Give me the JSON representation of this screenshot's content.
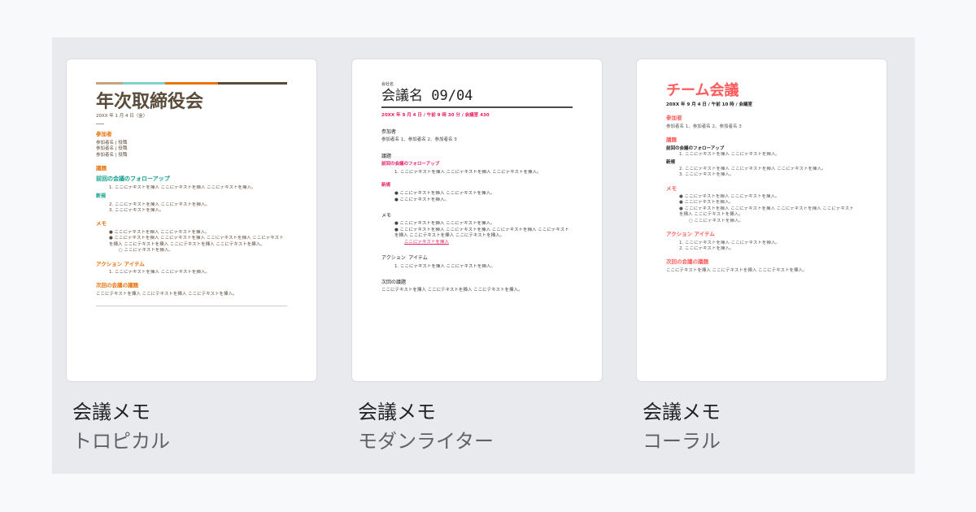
{
  "templates": [
    {
      "name": "会議メモ",
      "style": "トロピカル",
      "preview": {
        "title": "年次取締役会",
        "date": "20XX 年 1 月 4 日（金）",
        "attendees_heading": "参加者",
        "attendees": [
          "参加者名 | 役職",
          "参加者名 | 役職",
          "参加者名 | 役職"
        ],
        "agenda_heading": "議題",
        "followup_heading": "前回の会議のフォローアップ",
        "followup_items": [
          "1. ここにテキストを挿入 ここにテキストを挿入 ここにテキストを挿入。"
        ],
        "new_heading": "新規",
        "new_items": [
          "2. ここにテキストを挿入 ここにテキストを挿入。",
          "3. ここにテキストを挿入。"
        ],
        "notes_heading": "メモ",
        "notes_items": [
          "● ここにテキストを挿入 ここにテキストを挿入。",
          "● ここにテキストを挿入 ここにテキストを挿入 ここにテキストを挿入 ここにテキストを挿入 ここにテキストを挿入 ここにテキストを挿入 ここにテキストを挿入。",
          "○ ここにテキストを挿入。"
        ],
        "action_heading": "アクション アイテム",
        "action_items": [
          "1. ここにテキストを挿入 ここにテキストを挿入。"
        ],
        "next_heading": "次回の会議の議題",
        "next_text": "ここにテキストを挿入 ここにテキストを挿入 ここにテキストを挿入。"
      }
    },
    {
      "name": "会議メモ",
      "style": "モダンライター",
      "preview": {
        "company": "会社名",
        "title": "会議名 09/04",
        "datetime": "20XX 年 9 月 4 日 / 午前 9 時 30 分 / 会議室 430",
        "attendees_heading": "参加者",
        "attendees": "参加者名 1、参加者名 2、参加者名 3",
        "agenda_heading": "議題",
        "followup_heading": "前回の会議のフォローアップ",
        "followup_items": [
          "1. ここにテキストを挿入 ここにテキストを挿入 ここにテキストを挿入。"
        ],
        "new_heading": "新規",
        "new_items": [
          "● ここにテキストを挿入 ここにテキストを挿入。",
          "● ここにテキストを挿入。"
        ],
        "notes_heading": "メモ",
        "notes_items": [
          "● ここにテキストを挿入 ここにテキストを挿入。",
          "● ここにテキストを挿入 ここにテキストを挿入 ここにテキストを挿入 ここにテキストを挿入 ここにテキストを挿入 ここにテキストを挿入。"
        ],
        "notes_link": "ここにテキストを挿入",
        "action_heading": "アクション アイテム",
        "action_items": [
          "1. ここにテキストを挿入 ここにテキストを挿入。"
        ],
        "next_heading": "次回の議題",
        "next_text": "ここにテキストを挿入 ここにテキストを挿入 ここにテキストを挿入。"
      }
    },
    {
      "name": "会議メモ",
      "style": "コーラル",
      "preview": {
        "title": "チーム会議",
        "datetime": "20XX 年 9 月 4 日 / 午前 10 時 / 会議室",
        "attendees_heading": "参加者",
        "attendees": "参加者名 1、参加者名 2、参加者名 3",
        "agenda_heading": "議題",
        "followup_heading": "前回の会議のフォローアップ",
        "followup_items": [
          "1. ここにテキストを挿入 ここにテキストを挿入。"
        ],
        "new_heading": "新規",
        "new_items": [
          "2. ここにテキストを挿入 ここにテキストを挿入 ここにテキストを挿入。",
          "3. ここにテキストを挿入。"
        ],
        "notes_heading": "メモ",
        "notes_items": [
          "ここにテキストを挿入 ここにテキストを挿入。",
          "ここにテキストを挿入。",
          "ここにテキストを挿入 ここにテキストを挿入 ここにテキストを挿入 ここにテキストを挿入 ここにテキストを挿入。",
          "○ ここにテキストを挿入。"
        ],
        "action_heading": "アクション アイテム",
        "action_items": [
          "1. ここにテキストを挿入 ここにテキストを挿入。",
          "2. ここにテキストを挿入。"
        ],
        "next_heading": "次回の会議の議題",
        "next_text": "ここにテキストを挿入 ここにテキストを挿入 ここにテキストを挿入。"
      }
    }
  ],
  "colors": {
    "tropical_stripe": [
      "#c9a27e",
      "#7fd3cc",
      "#e8710a",
      "#5b4b3a"
    ],
    "tropical_accent": "#e8710a",
    "tropical_teal": "#0f9d8a",
    "modern_accent": "#e91e63",
    "coral_accent": "#ff5a5a"
  }
}
